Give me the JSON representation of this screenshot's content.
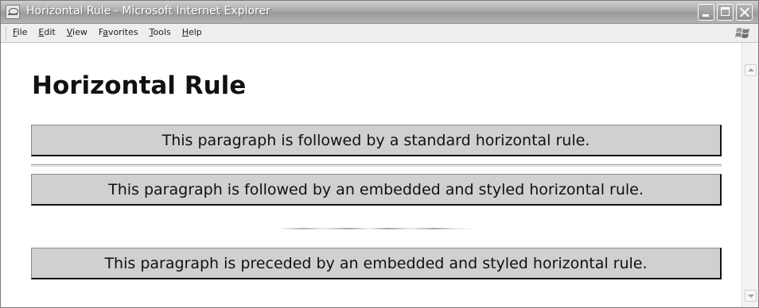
{
  "window": {
    "title": "Horizontal Rule - Microsoft Internet Explorer",
    "app_icon": "internet-explorer-icon",
    "buttons": [
      "minimize",
      "maximize",
      "close"
    ]
  },
  "menubar": {
    "items": [
      {
        "label": "File",
        "accesskey": "F"
      },
      {
        "label": "Edit",
        "accesskey": "E"
      },
      {
        "label": "View",
        "accesskey": "V"
      },
      {
        "label": "Favorites",
        "accesskey": "a"
      },
      {
        "label": "Tools",
        "accesskey": "T"
      },
      {
        "label": "Help",
        "accesskey": "H"
      }
    ],
    "brand_icon": "windows-flag-icon"
  },
  "content": {
    "heading": "Horizontal Rule",
    "paragraphs": [
      "This paragraph is followed by a standard horizontal rule.",
      "This paragraph is followed by an embedded and styled horizontal rule.",
      "This paragraph is preceded by an embedded and styled horizontal rule."
    ]
  },
  "colors": {
    "paragraph_background": "#d0d0d0",
    "paragraph_border_dark": "#111111",
    "title_bar": "#a9a9a9",
    "menubar_background": "#eeeeee"
  }
}
